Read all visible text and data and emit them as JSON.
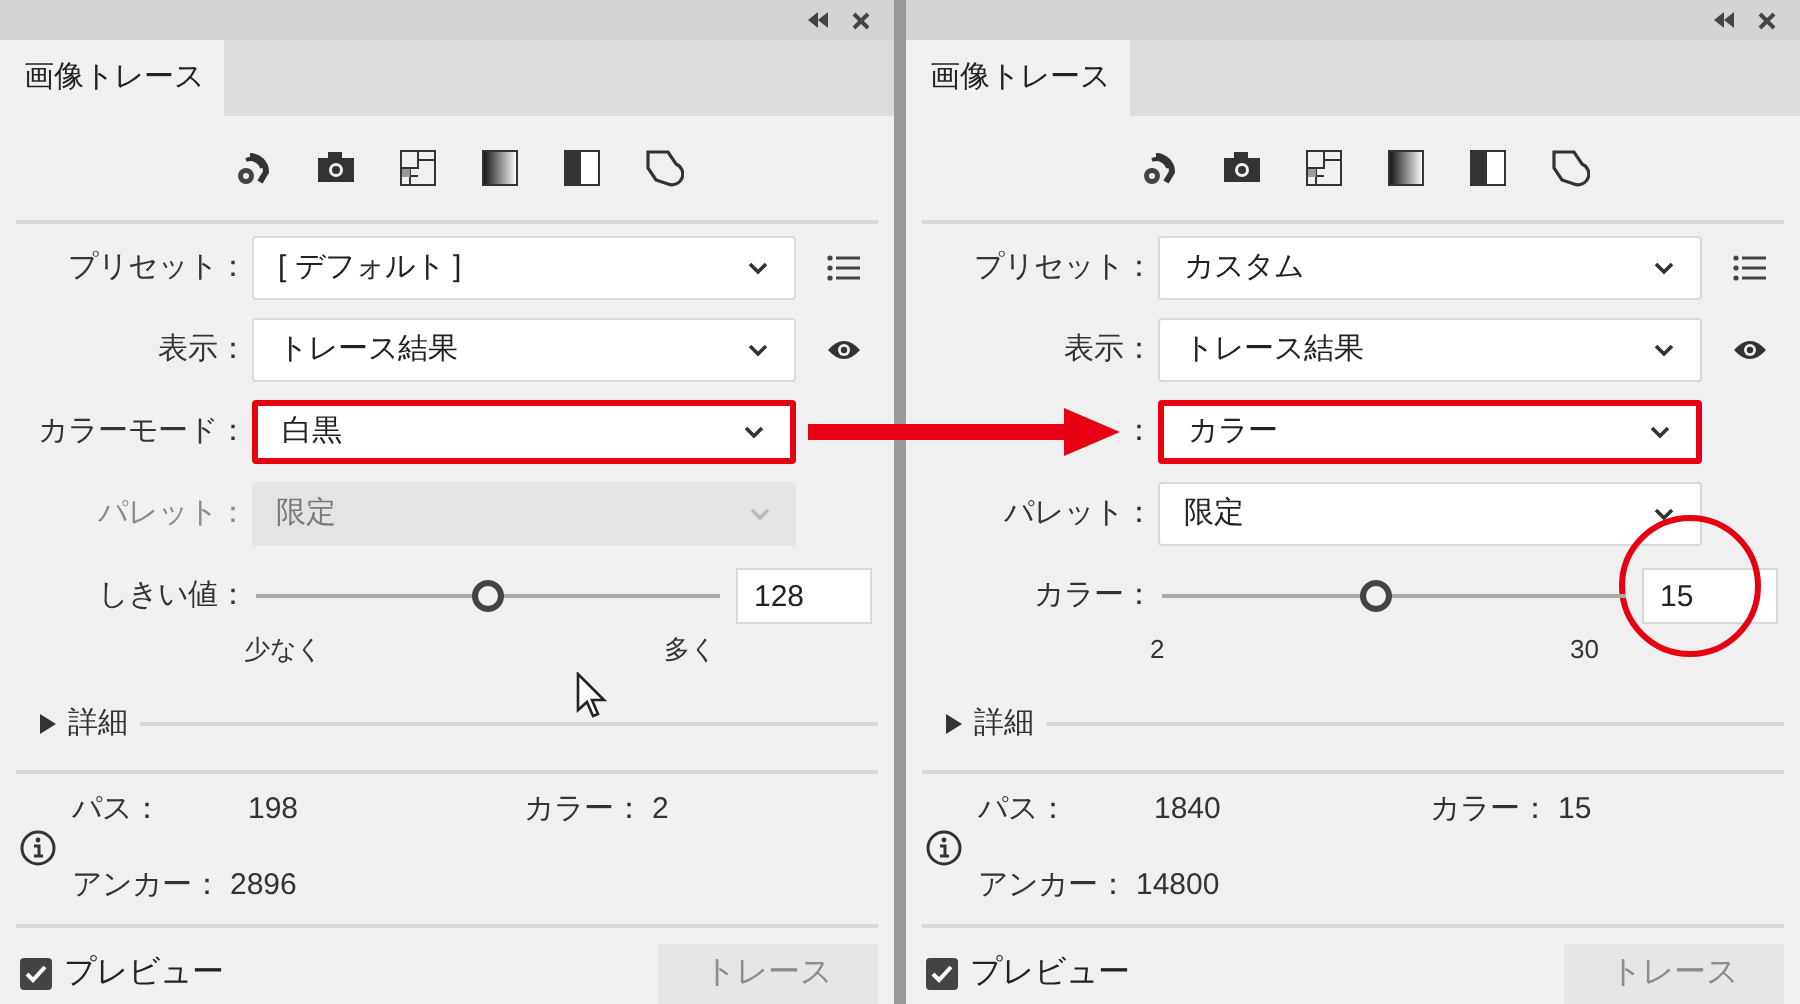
{
  "panels": [
    {
      "tab": {
        "label": "画像トレース",
        "selected": true
      },
      "rows": [
        {
          "kind": "dropdown",
          "label": "プリセット：",
          "value": "[ デフォルト ]",
          "disabled": false,
          "highlighted": false
        },
        {
          "kind": "dropdown",
          "label": "表示：",
          "value": "トレース結果",
          "disabled": false,
          "highlighted": false
        },
        {
          "kind": "dropdown",
          "label": "カラーモード：",
          "value": "白黒",
          "disabled": false,
          "highlighted": true
        },
        {
          "kind": "dropdown",
          "label": "パレット：",
          "value": "限定",
          "disabled": true,
          "highlighted": false
        },
        {
          "kind": "slider",
          "label": "しきい値：",
          "value": "128",
          "level": 0.5,
          "min_label": "少なく",
          "max_label": "多く",
          "circled": false
        }
      ],
      "details": {
        "label": "詳細",
        "expanded": false
      },
      "stats": [
        {
          "label": "パス：",
          "value": "198"
        },
        {
          "label": "カラー：",
          "value": "2"
        },
        {
          "label": "アンカー：",
          "value": "2896"
        }
      ],
      "preview": {
        "label": "プレビュー",
        "checked": true
      },
      "trace_button": {
        "label": "トレース",
        "disabled": true
      }
    },
    {
      "tab": {
        "label": "画像トレース",
        "selected": true
      },
      "rows": [
        {
          "kind": "dropdown",
          "label": "プリセット：",
          "value": "カスタム",
          "disabled": false,
          "highlighted": false
        },
        {
          "kind": "dropdown",
          "label": "表示：",
          "value": "トレース結果",
          "disabled": false,
          "highlighted": false
        },
        {
          "kind": "dropdown",
          "label": "：",
          "value": "カラー",
          "disabled": false,
          "highlighted": true
        },
        {
          "kind": "dropdown",
          "label": "パレット：",
          "value": "限定",
          "disabled": false,
          "highlighted": false
        },
        {
          "kind": "slider",
          "label": "カラー：",
          "value": "15",
          "level": 0.46,
          "min_label": "2",
          "max_label": "30",
          "circled": true
        }
      ],
      "details": {
        "label": "詳細",
        "expanded": false
      },
      "stats": [
        {
          "label": "パス：",
          "value": "1840"
        },
        {
          "label": "カラー：",
          "value": "15"
        },
        {
          "label": "アンカー：",
          "value": "14800"
        }
      ],
      "preview": {
        "label": "プレビュー",
        "checked": true
      },
      "trace_button": {
        "label": "トレース",
        "disabled": true
      }
    }
  ]
}
